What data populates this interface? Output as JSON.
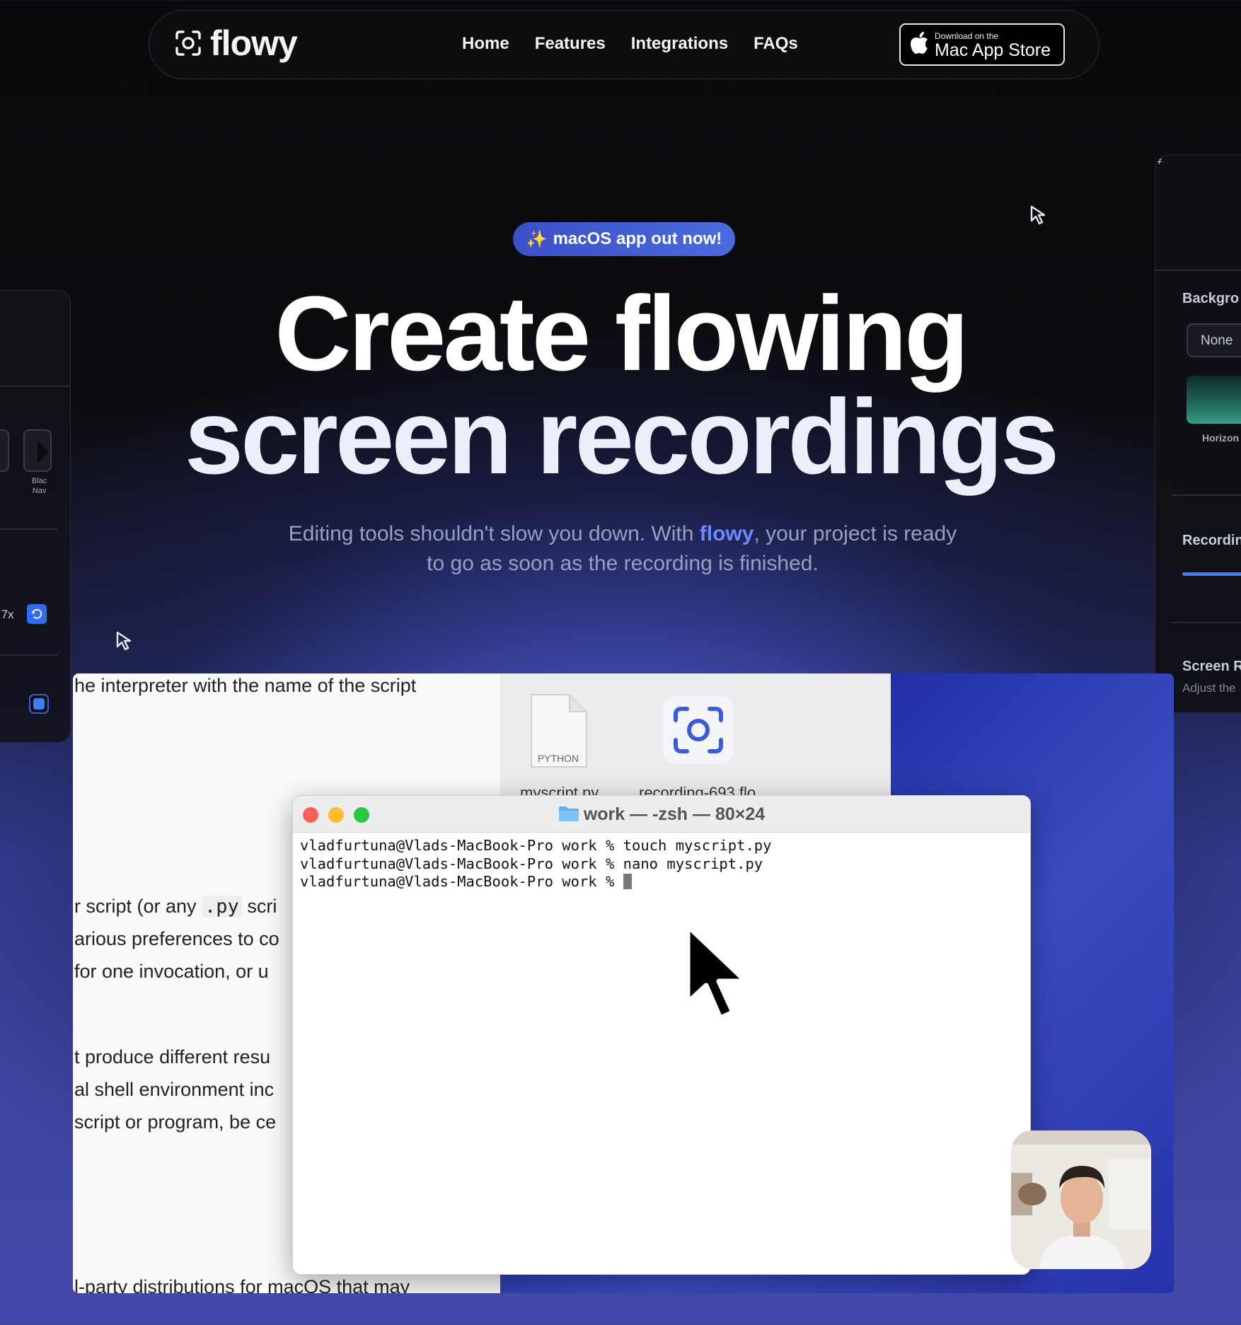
{
  "nav": {
    "logo_text": "flowy",
    "links": [
      "Home",
      "Features",
      "Integrations",
      "FAQs"
    ],
    "store_small": "Download on the",
    "store_big": "Mac App Store"
  },
  "badge": {
    "emoji": "✨",
    "text": "macOS app out now!"
  },
  "hero": {
    "line1": "Create flowing",
    "line2": "screen recordings",
    "sub_before": "Editing tools shouldn't slow you down. With ",
    "sub_brand": "flowy",
    "sub_after": ", your project is ready",
    "sub_line2": "to go as soon as the recording is finished."
  },
  "left_panel": {
    "thumb_label_1": "Blac",
    "thumb_label_2": "Nav",
    "speed": ".7x"
  },
  "right_panel": {
    "background_title": "Backgro",
    "none_button": "None",
    "horizon_label": "Horizon",
    "recording_title": "Recordin",
    "screen_title": "Screen R",
    "screen_sub": "Adjust the"
  },
  "document": {
    "line1": "he interpreter with the name of the script",
    "line2_pre": "r script (or any ",
    "line2_code": ".py",
    "line2_post": " scri",
    "line3": "arious preferences to co",
    "line4": " for one invocation, or u",
    "line5": "t produce different resu",
    "line6": "al shell environment inc",
    "line7": "script or program, be ce",
    "line8": "l-party distributions for macOS that may"
  },
  "finder": {
    "file1_type": "PYTHON",
    "file1_name": "myscript.py",
    "file2_name": "recording-693.flo"
  },
  "terminal": {
    "title": "work — -zsh — 80×24",
    "lines": [
      "vladfurtuna@Vlads-MacBook-Pro work % touch myscript.py",
      "vladfurtuna@Vlads-MacBook-Pro work % nano myscript.py",
      "vladfurtuna@Vlads-MacBook-Pro work % "
    ]
  },
  "colors": {
    "accent": "#4a6ae0",
    "brand_text": "#6d88ff",
    "close": "#fe5f57",
    "minimize": "#febc2e",
    "maximize": "#28c840"
  }
}
